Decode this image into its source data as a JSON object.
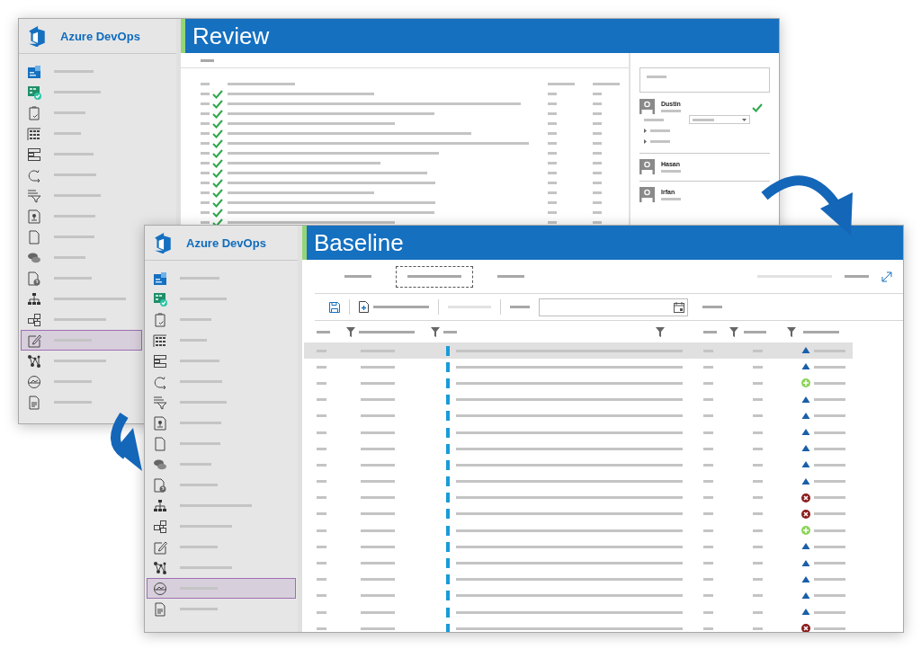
{
  "review_window": {
    "app_name": "Azure DevOps",
    "title": "Review",
    "nav": [
      {
        "selected": false
      },
      {
        "selected": false
      },
      {
        "selected": false
      },
      {
        "selected": false
      },
      {
        "selected": false
      },
      {
        "selected": false
      },
      {
        "selected": false
      },
      {
        "selected": false
      },
      {
        "selected": false
      },
      {
        "selected": false
      },
      {
        "selected": false
      },
      {
        "selected": false
      },
      {
        "selected": false
      },
      {
        "selected": true
      },
      {
        "selected": false
      },
      {
        "selected": false
      },
      {
        "selected": false
      }
    ],
    "rows": [
      {
        "approved": true
      },
      {
        "approved": true
      },
      {
        "approved": true
      },
      {
        "approved": true
      },
      {
        "approved": true
      },
      {
        "approved": true
      },
      {
        "approved": true
      },
      {
        "approved": true
      },
      {
        "approved": true
      },
      {
        "approved": true
      },
      {
        "approved": true
      },
      {
        "approved": true
      },
      {
        "approved": true
      },
      {
        "approved": true
      }
    ],
    "reviewers": [
      {
        "name": "Dustin",
        "approved": true,
        "expanded": true
      },
      {
        "name": "Hasan",
        "approved": false,
        "expanded": false
      },
      {
        "name": "Irfan",
        "approved": false,
        "expanded": false
      }
    ]
  },
  "baseline_window": {
    "app_name": "Azure DevOps",
    "title": "Baseline",
    "nav": [
      {
        "selected": false
      },
      {
        "selected": false
      },
      {
        "selected": false
      },
      {
        "selected": false
      },
      {
        "selected": false
      },
      {
        "selected": false
      },
      {
        "selected": false
      },
      {
        "selected": false
      },
      {
        "selected": false
      },
      {
        "selected": false
      },
      {
        "selected": false
      },
      {
        "selected": false
      },
      {
        "selected": false
      },
      {
        "selected": false
      },
      {
        "selected": false
      },
      {
        "selected": true
      },
      {
        "selected": false
      }
    ],
    "tabs": [
      {
        "selected": false
      },
      {
        "selected": true
      },
      {
        "selected": false
      }
    ],
    "rows": [
      {
        "kind": "changed",
        "selected": true
      },
      {
        "kind": "changed",
        "selected": false
      },
      {
        "kind": "added",
        "selected": false
      },
      {
        "kind": "changed",
        "selected": false
      },
      {
        "kind": "changed",
        "selected": false
      },
      {
        "kind": "changed",
        "selected": false
      },
      {
        "kind": "changed",
        "selected": false
      },
      {
        "kind": "changed",
        "selected": false
      },
      {
        "kind": "changed",
        "selected": false
      },
      {
        "kind": "removed",
        "selected": false
      },
      {
        "kind": "removed",
        "selected": false
      },
      {
        "kind": "added",
        "selected": false
      },
      {
        "kind": "changed",
        "selected": false
      },
      {
        "kind": "changed",
        "selected": false
      },
      {
        "kind": "changed",
        "selected": false
      },
      {
        "kind": "changed",
        "selected": false
      },
      {
        "kind": "changed",
        "selected": false
      },
      {
        "kind": "removed",
        "selected": false
      }
    ]
  }
}
